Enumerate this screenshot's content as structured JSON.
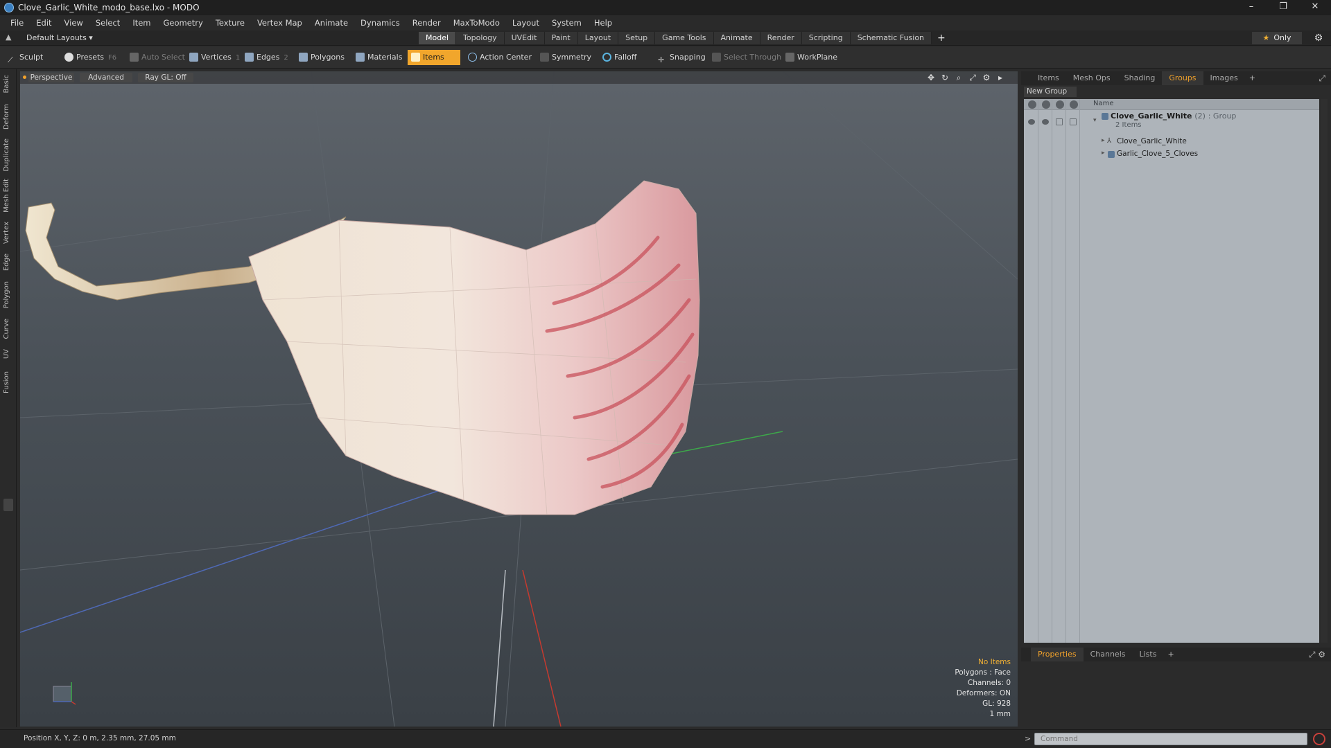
{
  "window": {
    "title": "Clove_Garlic_White_modo_base.lxo - MODO",
    "controls": [
      "–",
      "❐",
      "✕"
    ]
  },
  "menu": [
    "File",
    "Edit",
    "View",
    "Select",
    "Item",
    "Geometry",
    "Texture",
    "Vertex Map",
    "Animate",
    "Dynamics",
    "Render",
    "MaxToModo",
    "Layout",
    "System",
    "Help"
  ],
  "layout": {
    "selector": "Default Layouts ▾",
    "tabs": [
      "Model",
      "Topology",
      "UVEdit",
      "Paint",
      "Layout",
      "Setup",
      "Game Tools",
      "Animate",
      "Render",
      "Scripting",
      "Schematic Fusion"
    ],
    "active_tab": "Model",
    "only_label": "Only"
  },
  "toolbar": {
    "sculpt": "Sculpt",
    "presets": "Presets",
    "presets_key": "F6",
    "auto_select": "Auto Select",
    "vertices": "Vertices",
    "vertices_key": "1",
    "edges": "Edges",
    "edges_key": "2",
    "polygons": "Polygons",
    "materials": "Materials",
    "items": "Items",
    "action_center": "Action Center",
    "symmetry": "Symmetry",
    "falloff": "Falloff",
    "snapping": "Snapping",
    "select_through": "Select Through",
    "workplane": "WorkPlane"
  },
  "left_tabs": [
    "Basic",
    "Deform",
    "Duplicate",
    "Mesh Edit",
    "Vertex",
    "Edge",
    "Polygon",
    "Curve",
    "UV",
    "Fusion"
  ],
  "viewport": {
    "perspective": "Perspective",
    "advanced": "Advanced",
    "raygl": "Ray GL: Off",
    "info": {
      "no_items": "No Items",
      "polygons": "Polygons : Face",
      "channels": "Channels: 0",
      "deformers": "Deformers: ON",
      "gl": "GL: 928",
      "unit": "1 mm"
    }
  },
  "right_panel": {
    "tabs": [
      "Items",
      "Mesh Ops",
      "Shading",
      "Groups",
      "Images"
    ],
    "active_tab": "Groups",
    "new_group": "New Group",
    "name_header": "Name",
    "group": {
      "name": "Clove_Garlic_White",
      "count": "(2)",
      "type": ": Group",
      "sub": "2 Items",
      "children": [
        "Clove_Garlic_White",
        "Garlic_Clove_5_Cloves"
      ]
    }
  },
  "properties_panel": {
    "tabs": [
      "Properties",
      "Channels",
      "Lists"
    ],
    "active_tab": "Properties"
  },
  "status": {
    "position": "Position X, Y, Z:  0 m, 2.35 mm, 27.05 mm",
    "command_placeholder": "Command"
  },
  "colors": {
    "accent": "#f2a22b",
    "active_tool": "#f1a62c",
    "list_bg": "#aeb4ba"
  }
}
